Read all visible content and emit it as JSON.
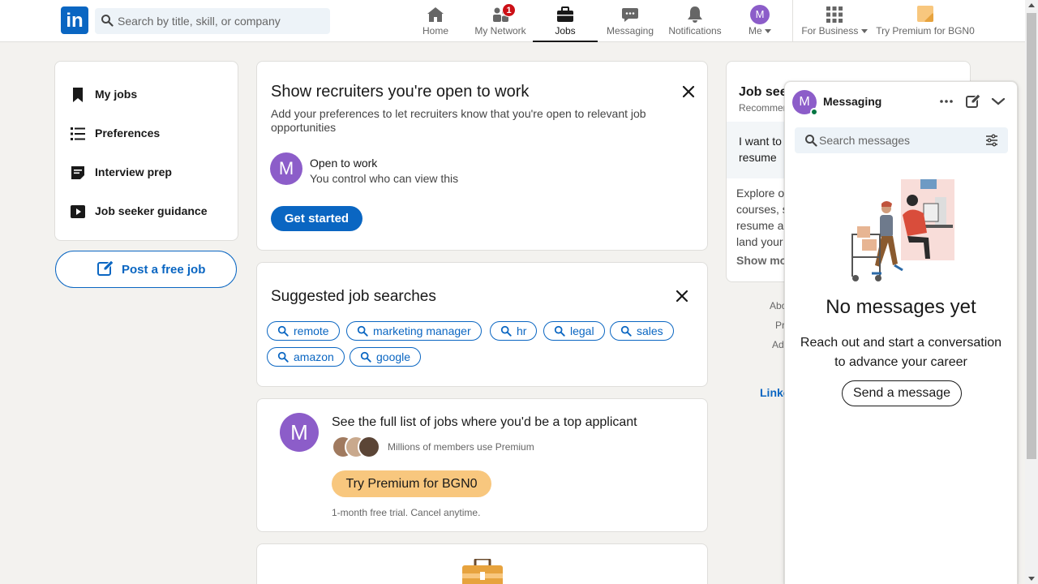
{
  "header": {
    "logo_text": "in",
    "search_placeholder": "Search by title, skill, or company",
    "nav": [
      {
        "label": "Home",
        "icon": "home-icon"
      },
      {
        "label": "My Network",
        "icon": "network-icon",
        "badge": "1"
      },
      {
        "label": "Jobs",
        "icon": "briefcase-icon",
        "active": true
      },
      {
        "label": "Messaging",
        "icon": "messaging-icon"
      },
      {
        "label": "Notifications",
        "icon": "bell-icon"
      },
      {
        "label": "Me",
        "icon": "avatar",
        "avatar_letter": "M"
      },
      {
        "label": "For Business",
        "icon": "grid-icon"
      },
      {
        "label": "Try Premium for BGN0",
        "icon": "premium-icon"
      }
    ]
  },
  "sidebar": {
    "items": [
      {
        "label": "My jobs",
        "icon": "bookmark-icon"
      },
      {
        "label": "Preferences",
        "icon": "list-icon"
      },
      {
        "label": "Interview prep",
        "icon": "clipboard-icon"
      },
      {
        "label": "Job seeker guidance",
        "icon": "video-icon"
      }
    ],
    "post_job_label": "Post a free job"
  },
  "open_to_work": {
    "title": "Show recruiters you're open to work",
    "description": "Add your preferences to let recruiters know that you're open to relevant job opportunities",
    "avatar_letter": "M",
    "heading": "Open to work",
    "subtext": "You control who can view this",
    "button": "Get started"
  },
  "suggested_searches": {
    "title": "Suggested job searches",
    "pills": [
      "remote",
      "marketing manager",
      "hr",
      "legal",
      "sales",
      "amazon",
      "google"
    ]
  },
  "premium_card": {
    "avatar_letter": "M",
    "title": "See the full list of jobs where you'd be a top applicant",
    "members_text": "Millions of members use Premium",
    "button": "Try Premium for BGN0",
    "footnote": "1-month free trial. Cancel anytime."
  },
  "right_card": {
    "title_fragment": "Job seek",
    "subtitle_fragment": "Recommen",
    "band_text_fragment": "I want to resume",
    "body_fragment_lines": [
      "Explore ou",
      "courses, s",
      "resume an",
      "land your"
    ],
    "show_more_fragment": "Show mo"
  },
  "footer_fragments": [
    "Abo",
    "Pr",
    "Ad"
  ],
  "linkedin_fragment": "Linke",
  "messaging": {
    "avatar_letter": "M",
    "title": "Messaging",
    "search_placeholder": "Search messages",
    "empty_title": "No messages yet",
    "empty_text": "Reach out and start a conversation to advance your career",
    "button": "Send a message"
  },
  "colors": {
    "brand_blue": "#0a66c2",
    "avatar_purple": "#8c5dc9",
    "premium_gold": "#f8c77e",
    "notification_red": "#cc1016",
    "online_green": "#057642"
  }
}
